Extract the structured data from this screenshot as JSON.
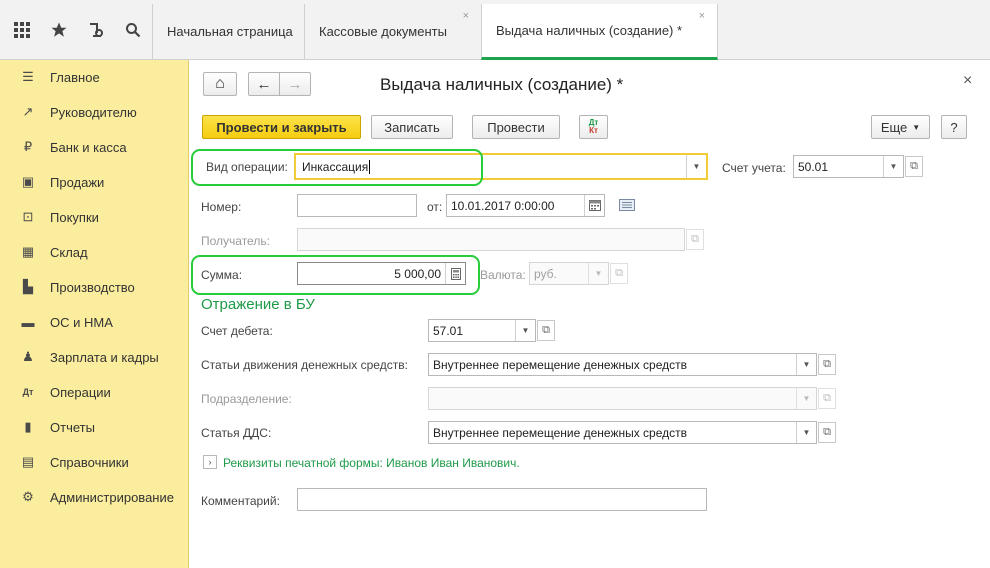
{
  "toolbar": {
    "icons": [
      "grid-icon",
      "star-icon",
      "history-icon",
      "search-icon"
    ]
  },
  "tabs": [
    {
      "label": "Начальная страница",
      "closable": false,
      "active": false
    },
    {
      "label": "Кассовые документы",
      "closable": true,
      "active": false
    },
    {
      "label": "Выдача наличных (создание) *",
      "closable": true,
      "active": true
    }
  ],
  "close_glyph": "×",
  "sidebar": {
    "items": [
      {
        "label": "Главное",
        "icon": "menu-icon",
        "glyph": "☰"
      },
      {
        "label": "Руководителю",
        "icon": "trend-icon",
        "glyph": "↗"
      },
      {
        "label": "Банк и касса",
        "icon": "ruble-icon",
        "glyph": "₽"
      },
      {
        "label": "Продажи",
        "icon": "bag-icon",
        "glyph": "▣"
      },
      {
        "label": "Покупки",
        "icon": "cart-icon",
        "glyph": "⊡"
      },
      {
        "label": "Склад",
        "icon": "warehouse-icon",
        "glyph": "▦"
      },
      {
        "label": "Производство",
        "icon": "factory-icon",
        "glyph": "▙"
      },
      {
        "label": "ОС и НМА",
        "icon": "truck-icon",
        "glyph": "▬"
      },
      {
        "label": "Зарплата и кадры",
        "icon": "people-icon",
        "glyph": "♟"
      },
      {
        "label": "Операции",
        "icon": "dtkt-icon",
        "glyph": "Дт"
      },
      {
        "label": "Отчеты",
        "icon": "chart-icon",
        "glyph": "▮"
      },
      {
        "label": "Справочники",
        "icon": "book-icon",
        "glyph": "▤"
      },
      {
        "label": "Администрирование",
        "icon": "gear-icon",
        "glyph": "⚙"
      }
    ]
  },
  "form": {
    "title": "Выдача наличных (создание) *",
    "nav": {
      "home": "⌂",
      "back": "←",
      "forward": "→"
    },
    "buttons": {
      "post_close": "Провести и закрыть",
      "save": "Записать",
      "post": "Провести",
      "dtkt_top": "Дт",
      "dtkt_bottom": "Кт",
      "more": "Еще",
      "help": "?"
    },
    "operation_type": {
      "label": "Вид операции:",
      "value": "Инкассация"
    },
    "account": {
      "label": "Счет учета:",
      "value": "50.01"
    },
    "number": {
      "label": "Номер:",
      "value": ""
    },
    "date": {
      "label": "от:",
      "value": "10.01.2017  0:00:00"
    },
    "recipient": {
      "label": "Получатель:",
      "value": ""
    },
    "amount": {
      "label": "Сумма:",
      "value": "5 000,00"
    },
    "currency": {
      "label": "Валюта:",
      "value": "руб."
    },
    "section_title": "Отражение в БУ",
    "debit_account": {
      "label": "Счет дебета:",
      "value": "57.01"
    },
    "cash_flow": {
      "label": "Статьи движения денежных средств:",
      "value": "Внутреннее перемещение денежных средств"
    },
    "department": {
      "label": "Подразделение:",
      "value": ""
    },
    "dds_item": {
      "label": "Статья ДДС:",
      "value": "Внутреннее перемещение денежных средств"
    },
    "print_details": "Реквизиты печатной формы: Иванов Иван Иванович.",
    "comment": {
      "label": "Комментарий:",
      "value": ""
    }
  },
  "colors": {
    "accent": "#1f9a49",
    "sidebar": "#fbed9e",
    "highlight": "#27cc3a",
    "primary": "#f5cc0f"
  }
}
